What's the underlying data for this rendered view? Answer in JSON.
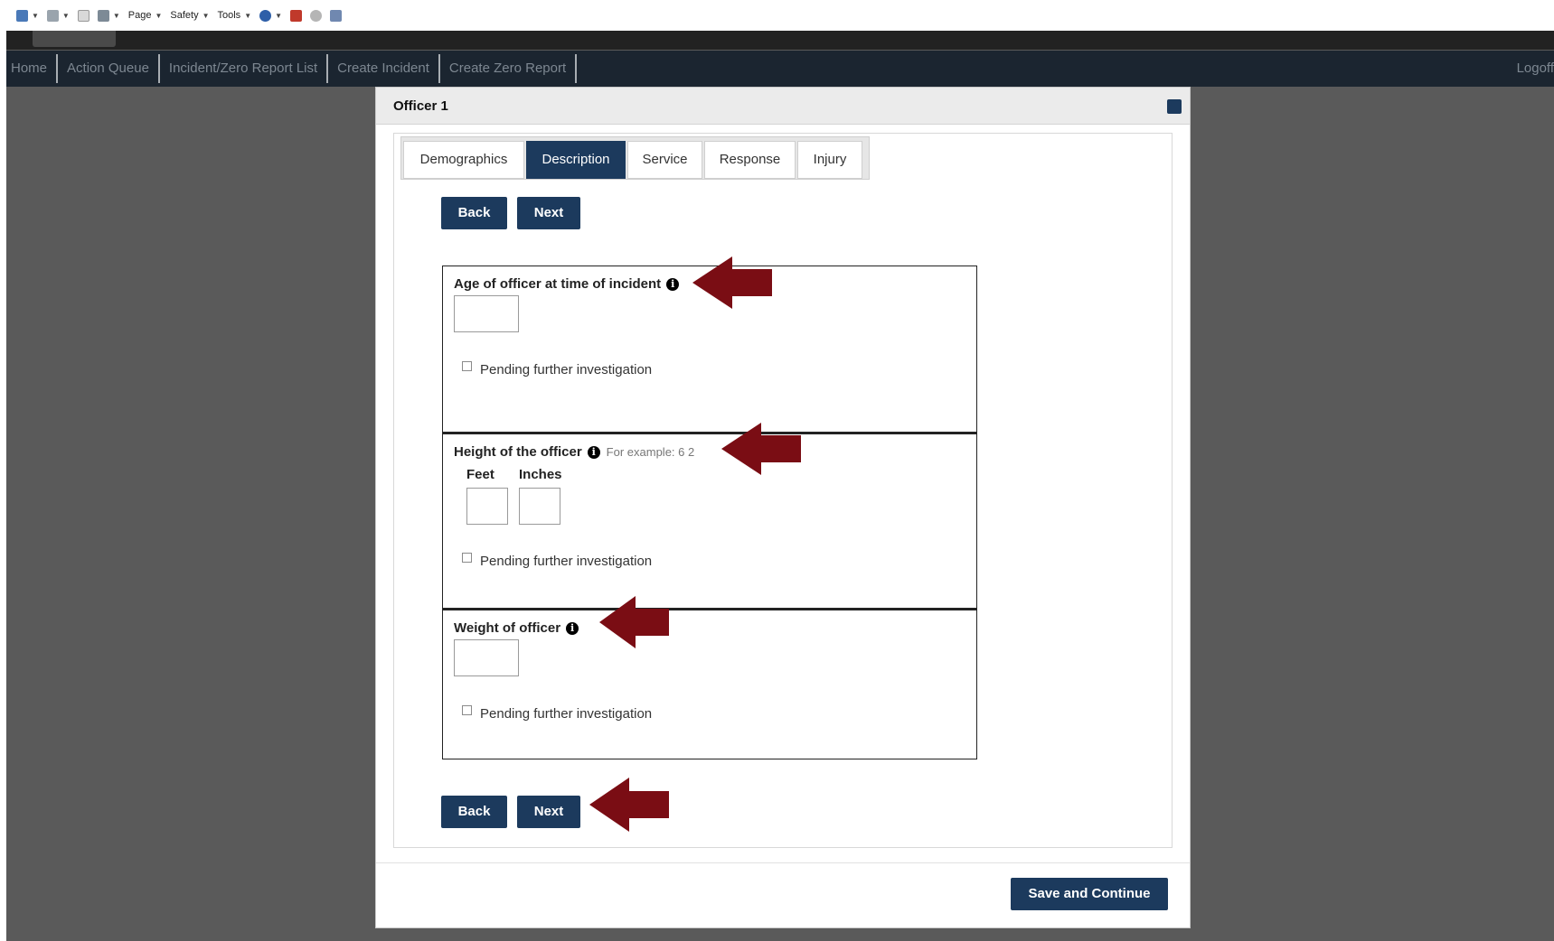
{
  "ie_toolbar": {
    "page_label": "Page",
    "safety_label": "Safety",
    "tools_label": "Tools"
  },
  "nav": {
    "items": [
      "Home",
      "Action Queue",
      "Incident/Zero Report List",
      "Create Incident",
      "Create Zero Report"
    ],
    "logoff": "Logoff"
  },
  "modal": {
    "title": "Officer 1",
    "tabs": [
      "Demographics",
      "Description",
      "Service",
      "Response",
      "Injury"
    ],
    "active_tab": "Description",
    "back_label": "Back",
    "next_label": "Next",
    "save_label": "Save and Continue",
    "age": {
      "label": "Age of officer at time of incident",
      "value": "",
      "pending_label": "Pending further investigation"
    },
    "height": {
      "label": "Height of the officer",
      "hint": "For example: 6 2",
      "feet_label": "Feet",
      "inches_label": "Inches",
      "feet_value": "",
      "inches_value": "",
      "pending_label": "Pending further investigation"
    },
    "weight": {
      "label": "Weight of officer",
      "value": "",
      "pending_label": "Pending further investigation"
    },
    "info_icon_glyph": "i"
  },
  "colors": {
    "primary": "#1c3a5d",
    "navbar": "#1b2530",
    "backdrop": "#5a5a5a",
    "annotation_arrow": "#7a0d14"
  }
}
